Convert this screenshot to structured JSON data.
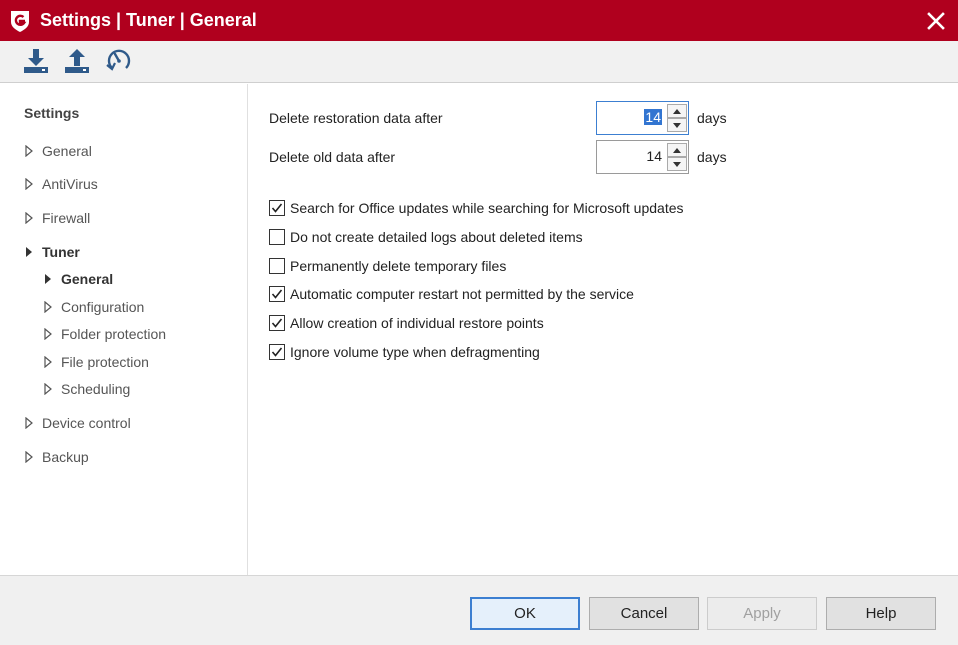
{
  "window": {
    "title": "Settings | Tuner | General",
    "brand_color": "#b0001e",
    "logo_letter": "G"
  },
  "toolbar": {
    "buttons": [
      {
        "icon": "import-icon"
      },
      {
        "icon": "export-icon"
      },
      {
        "icon": "restore-defaults-icon"
      }
    ]
  },
  "nav": {
    "heading": "Settings",
    "items": [
      {
        "label": "General",
        "level": 0,
        "expanded": false
      },
      {
        "label": "AntiVirus",
        "level": 0,
        "expanded": false
      },
      {
        "label": "Firewall",
        "level": 0,
        "expanded": false
      },
      {
        "label": "Tuner",
        "level": 0,
        "expanded": true
      },
      {
        "label": "General",
        "level": 1,
        "selected": true
      },
      {
        "label": "Configuration",
        "level": 1
      },
      {
        "label": "Folder protection",
        "level": 1
      },
      {
        "label": "File protection",
        "level": 1
      },
      {
        "label": "Scheduling",
        "level": 1
      },
      {
        "label": "Device control",
        "level": 0,
        "expanded": false
      },
      {
        "label": "Backup",
        "level": 0,
        "expanded": false
      }
    ]
  },
  "main": {
    "restoration": {
      "label": "Delete restoration data after",
      "value": "14",
      "unit": "days"
    },
    "old_data": {
      "label": "Delete old data after",
      "value": "14",
      "unit": "days"
    },
    "options": [
      {
        "label": "Search for Office updates while searching for Microsoft updates",
        "checked": true
      },
      {
        "label": "Do not create detailed logs about deleted items",
        "checked": false
      },
      {
        "label": "Permanently delete temporary files",
        "checked": false
      },
      {
        "label": "Automatic computer restart not permitted by the service",
        "checked": true
      },
      {
        "label": "Allow creation of individual restore points",
        "checked": true
      },
      {
        "label": "Ignore volume type when defragmenting",
        "checked": true
      }
    ]
  },
  "footer": {
    "ok_label": "OK",
    "cancel_label": "Cancel",
    "apply_label": "Apply",
    "help_label": "Help"
  }
}
